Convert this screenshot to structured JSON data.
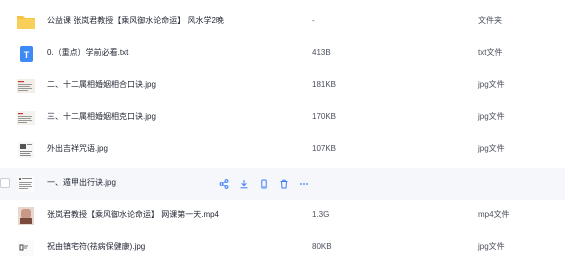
{
  "files": [
    {
      "icon": "folder-icon",
      "name": "公益课 张岚君教授【乘风御水论命运】 风水学2晚",
      "size": "-",
      "type": "文件夹"
    },
    {
      "icon": "text-file-icon",
      "name": "0.（重点）学前必看.txt",
      "size": "413B",
      "type": "txt文件"
    },
    {
      "icon": "image-thumbnail-icon",
      "name": "二、十二属相婚姻相合口诀.jpg",
      "size": "181KB",
      "type": "jpg文件"
    },
    {
      "icon": "image-thumbnail-icon",
      "name": "三、十二属相婚姻相克口诀.jpg",
      "size": "170KB",
      "type": "jpg文件"
    },
    {
      "icon": "image-thumbnail-icon",
      "name": "外出吉祥咒语.jpg",
      "size": "107KB",
      "type": "jpg文件"
    },
    {
      "icon": "image-thumbnail-icon",
      "name": "一、遁甲出行诀.jpg",
      "size": "",
      "type": ""
    },
    {
      "icon": "video-thumbnail-icon",
      "name": "张岚君教授【乘风御水论命运】 网课第一天.mp4",
      "size": "1.3G",
      "type": "mp4文件"
    },
    {
      "icon": "image-thumbnail-icon",
      "name": "祝由镇宅符(祛病保健康).jpg",
      "size": "80KB",
      "type": "jpg文件"
    }
  ],
  "hover_actions": [
    "share-icon",
    "download-icon",
    "phone-icon",
    "delete-icon",
    "more-icon"
  ],
  "colors": {
    "folder": "#f6c342",
    "text_file": "#3d8af7",
    "action_icon": "#3d7bf7",
    "hover_row": "#f5f7fb"
  }
}
